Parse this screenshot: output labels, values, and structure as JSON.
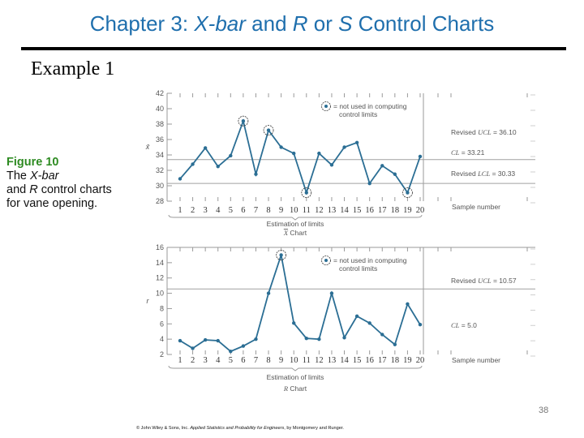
{
  "slide": {
    "title_prefix": "Chapter 3: ",
    "title_xbar": "X-bar",
    "title_mid1": " and ",
    "title_r": "R",
    "title_mid2": " or ",
    "title_s": "S",
    "title_suffix": " Control Charts",
    "example": "Example 1",
    "caption_figure": "Figure 10",
    "caption_line1_a": "The ",
    "caption_line1_b": "X-bar",
    "caption_line2_a": "and ",
    "caption_line2_b": "R",
    "caption_line2_c": " control charts",
    "caption_line3": "for vane opening.",
    "page_number": "38",
    "credit_a": "© John Wiley & Sons, Inc. ",
    "credit_b": "Applied Statistics and Probability for Engineers",
    "credit_c": ", by Montgomery and Runger."
  },
  "chart_data": [
    {
      "type": "line",
      "title": "X̄ Chart",
      "ylabel": "x̄",
      "xlabel": "Sample number",
      "x": [
        1,
        2,
        3,
        4,
        5,
        6,
        7,
        8,
        9,
        10,
        11,
        12,
        13,
        14,
        15,
        16,
        17,
        18,
        19,
        20
      ],
      "values": [
        30.9,
        32.8,
        34.9,
        32.5,
        33.9,
        38.4,
        31.5,
        37.2,
        35.0,
        34.2,
        29.1,
        34.2,
        32.7,
        35.0,
        35.6,
        30.3,
        32.6,
        31.5,
        29.1,
        33.8
      ],
      "excluded_points": [
        6,
        8,
        11,
        19
      ],
      "ylim": [
        28,
        42
      ],
      "yticks": [
        28,
        30,
        32,
        34,
        36,
        38,
        40,
        42
      ],
      "limit_lines": [
        {
          "name": "CL",
          "value": 33.4
        },
        {
          "name": "LCL",
          "value": 30.3
        }
      ],
      "limit_labels": [
        {
          "prefix": "Revised ",
          "name": "UCL",
          "text": " = 36.10"
        },
        {
          "prefix": "",
          "name": "CL",
          "text": " = 33.21"
        },
        {
          "prefix": "Revised ",
          "name": "LCL",
          "text": " = 30.33"
        }
      ],
      "legend": {
        "line1": "= not used in computing",
        "line2": "control limits",
        "position": "top-right"
      },
      "brace_label": "Estimation of limits",
      "color": "#2b6e94"
    },
    {
      "type": "line",
      "title": "R Chart",
      "ylabel": "r",
      "xlabel": "Sample number",
      "x": [
        1,
        2,
        3,
        4,
        5,
        6,
        7,
        8,
        9,
        10,
        11,
        12,
        13,
        14,
        15,
        16,
        17,
        18,
        19,
        20
      ],
      "values": [
        3.8,
        2.8,
        3.9,
        3.8,
        2.4,
        3.1,
        4.0,
        10.0,
        15.0,
        6.1,
        4.1,
        4.0,
        10.0,
        4.2,
        7.0,
        6.1,
        4.6,
        3.3,
        8.6,
        5.9
      ],
      "excluded_points": [
        9
      ],
      "ylim": [
        2,
        16
      ],
      "yticks": [
        2,
        4,
        6,
        8,
        10,
        12,
        14,
        16
      ],
      "limit_lines": [
        {
          "name": "UCL",
          "value": 10.57
        }
      ],
      "limit_labels": [
        {
          "prefix": "Revised ",
          "name": "UCL",
          "text": " = 10.57"
        },
        {
          "prefix": "",
          "name": "CL",
          "text": " = 5.0"
        }
      ],
      "legend": {
        "line1": "= not used in computing",
        "line2": "control limits",
        "position": "top-right"
      },
      "brace_label": "Estimation of limits",
      "color": "#2b6e94"
    }
  ]
}
